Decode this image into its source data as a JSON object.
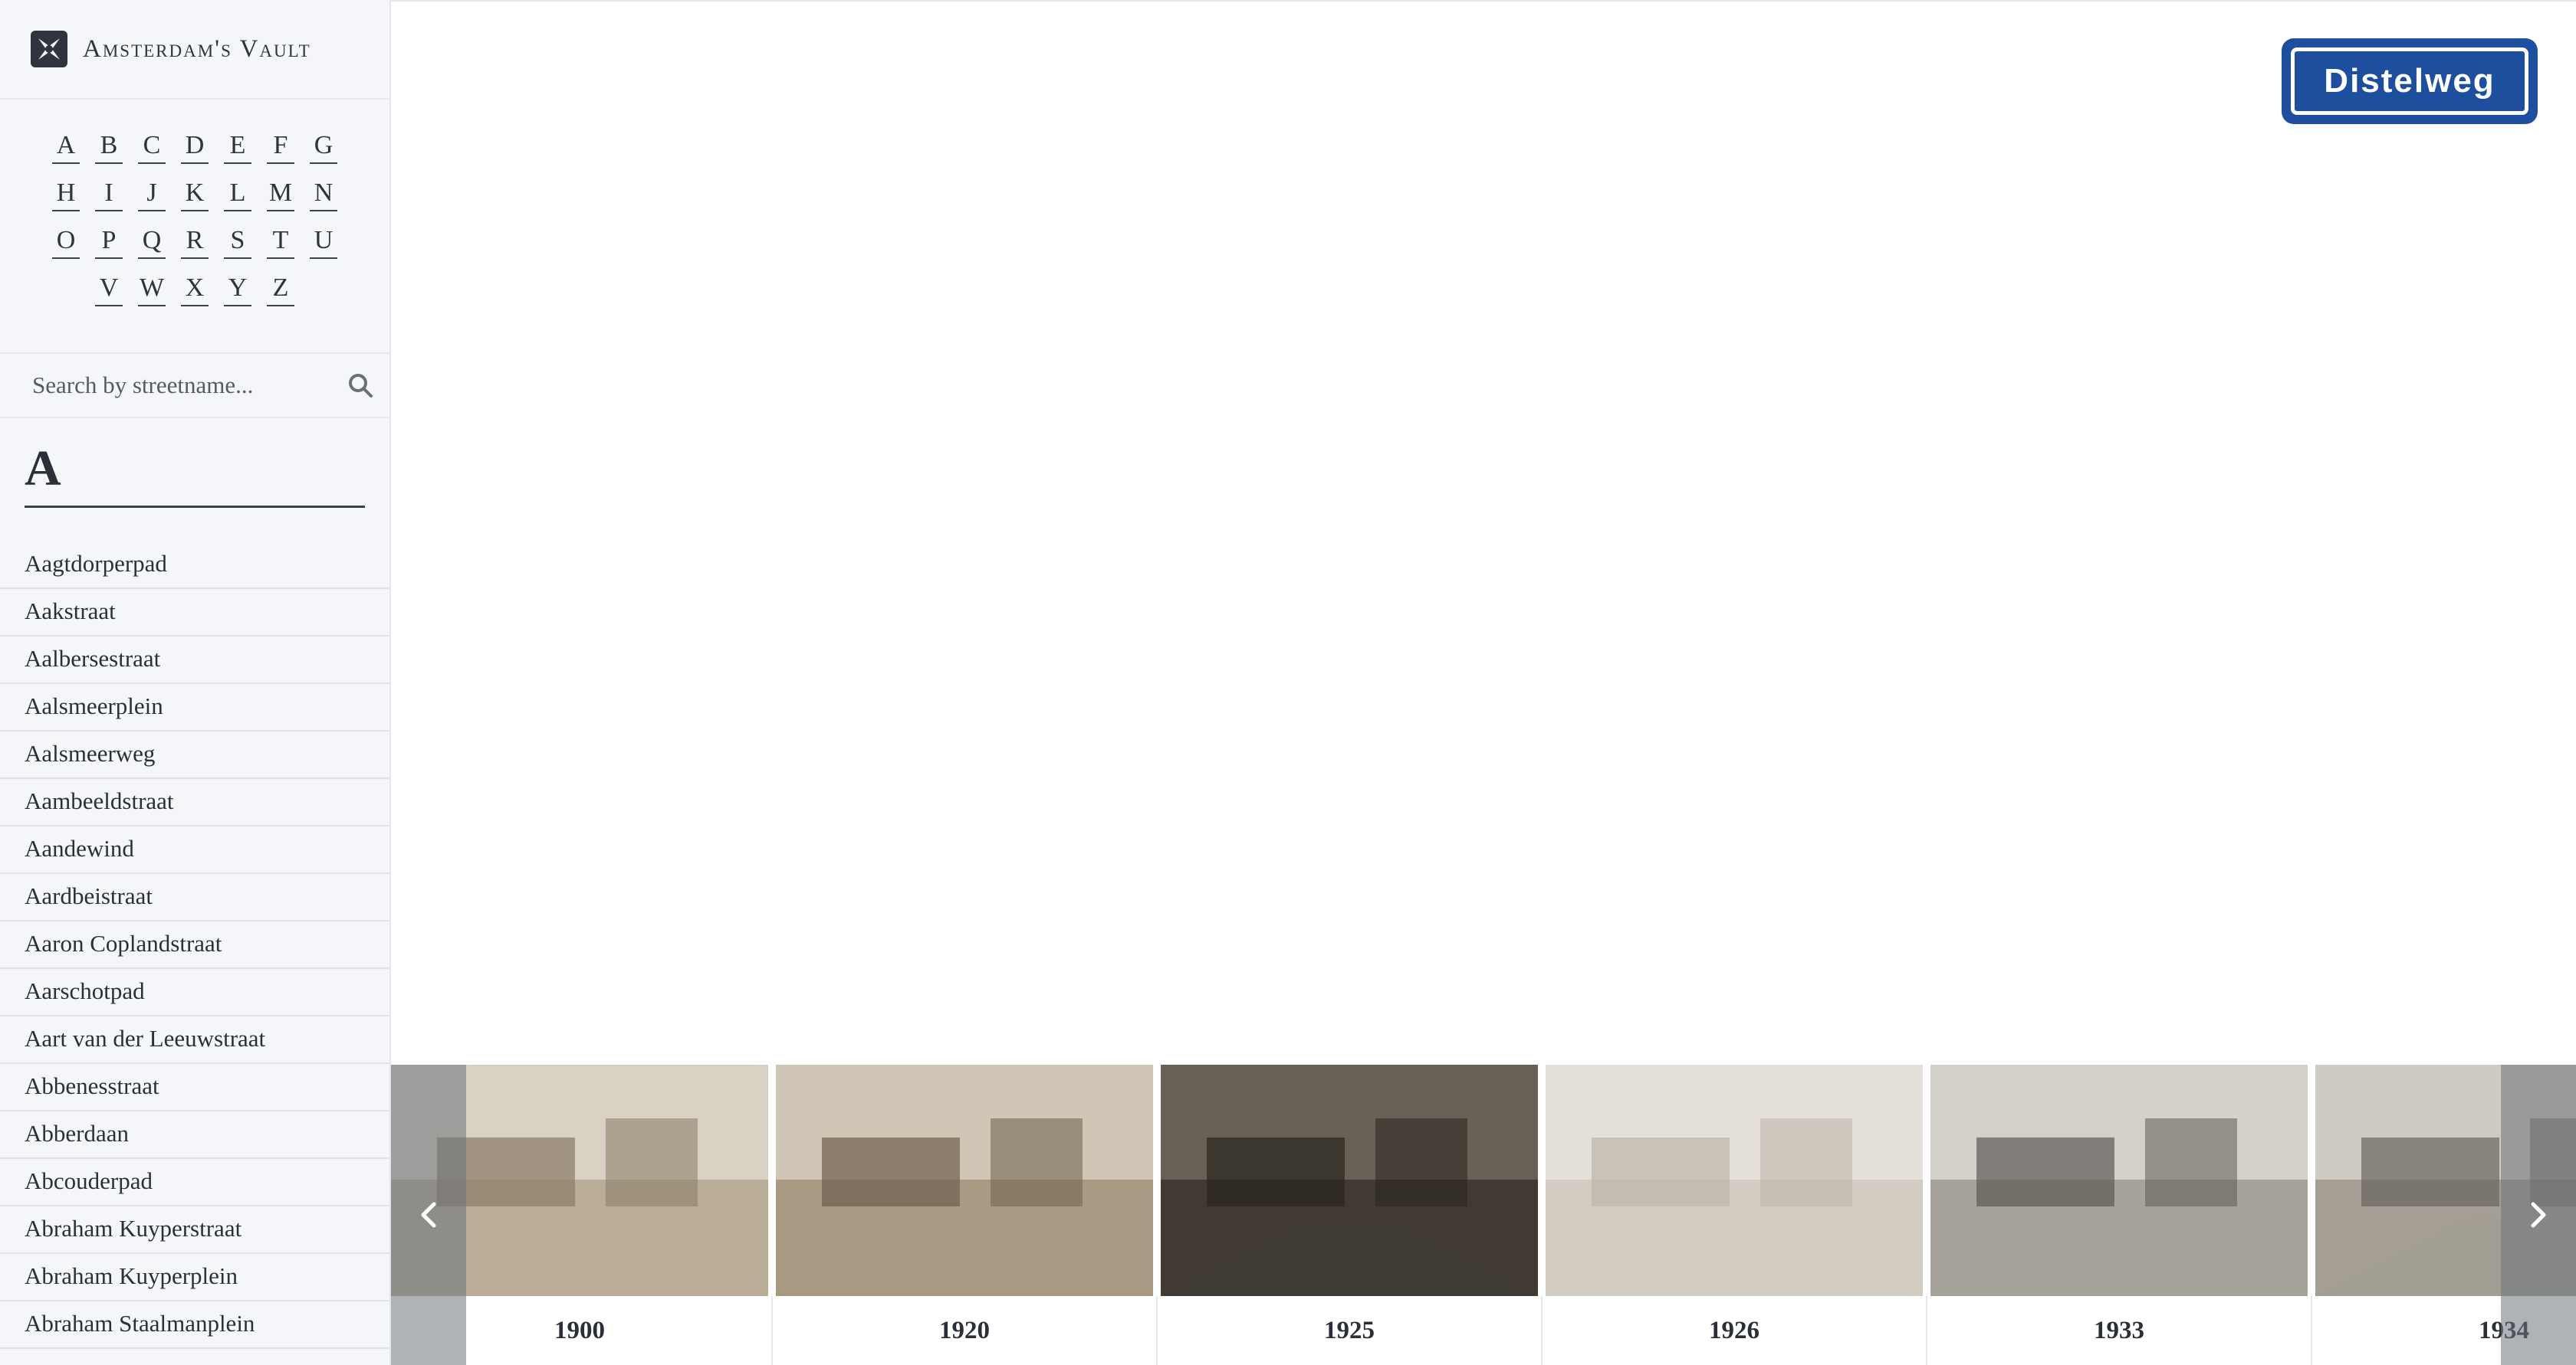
{
  "brand": {
    "title": "Amsterdam's Vault",
    "logo_icon": "cross-shield-icon"
  },
  "alphabet": {
    "rows": [
      [
        "A",
        "B",
        "C",
        "D",
        "E",
        "F",
        "G"
      ],
      [
        "H",
        "I",
        "J",
        "K",
        "L",
        "M",
        "N"
      ],
      [
        "O",
        "P",
        "Q",
        "R",
        "S",
        "T",
        "U"
      ],
      [
        "V",
        "W",
        "X",
        "Y",
        "Z"
      ]
    ]
  },
  "search": {
    "placeholder": "Search by streetname...",
    "icon": "search-icon"
  },
  "section": {
    "heading": "A"
  },
  "streets": [
    "Aagtdorperpad",
    "Aakstraat",
    "Aalbersestraat",
    "Aalsmeerplein",
    "Aalsmeerweg",
    "Aambeeldstraat",
    "Aandewind",
    "Aardbeistraat",
    "Aaron Coplandstraat",
    "Aarschotpad",
    "Aart van der Leeuwstraat",
    "Abbenesstraat",
    "Abberdaan",
    "Abcouderpad",
    "Abraham Kuyperstraat",
    "Abraham Kuyperplein",
    "Abraham Staalmanplein"
  ],
  "street_sign": {
    "label": "Distelweg",
    "color": "#1e4e9e"
  },
  "timeline": {
    "years": [
      "1900",
      "1920",
      "1925",
      "1926",
      "1933",
      "1934"
    ],
    "prev_icon": "chevron-left-icon",
    "next_icon": "chevron-right-icon"
  }
}
